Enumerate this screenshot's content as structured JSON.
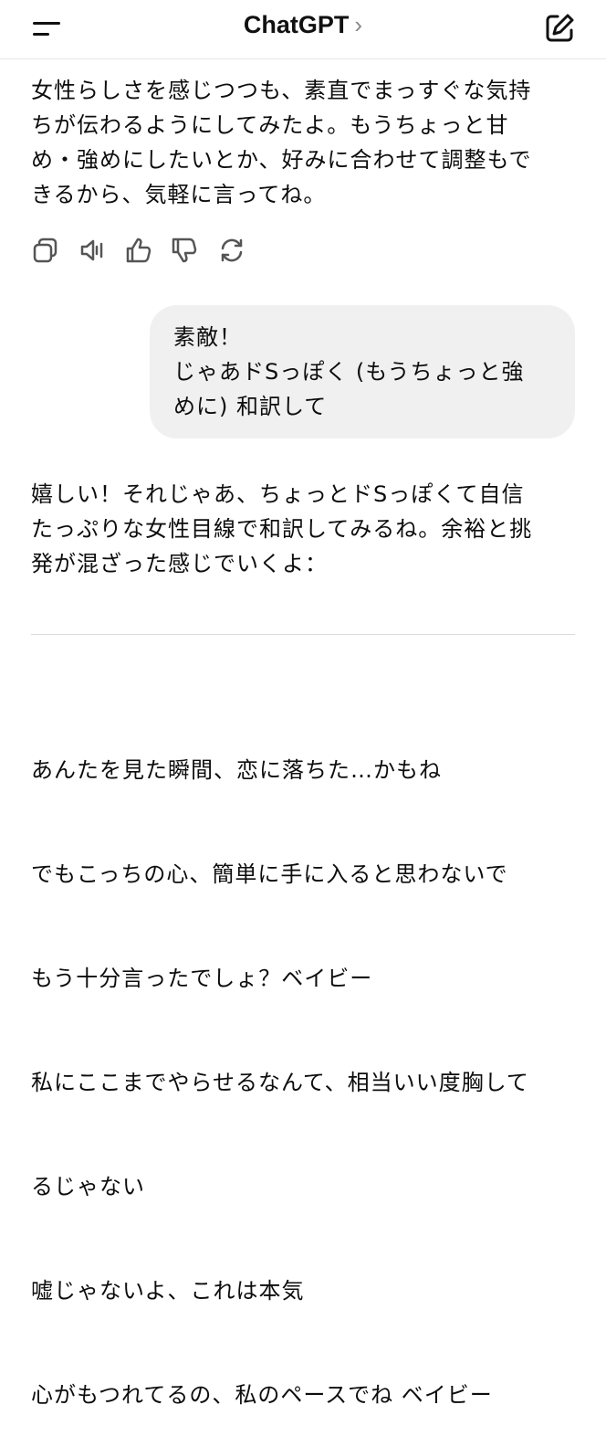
{
  "header": {
    "title": "ChatGPT",
    "chevron": "›"
  },
  "messages": {
    "assistant_1": "女性らしさを感じつつも、素直でまっすぐな気持\nちが伝わるようにしてみたよ。もうちょっと甘\nめ・強めにしたいとか、好みに合わせて調整もで\nきるから、気軽に言ってね。",
    "user_1": "素敵！\nじゃあドSっぽく (もうちょっと強\nめに) 和訳して",
    "assistant_2": "嬉しい！それじゃあ、ちょっとドSっぽくて自信\nたっぷりな女性目線で和訳してみるね。余裕と挑\n発が混ざった感じでいくよ：",
    "poem": [
      "あんたを見た瞬間、恋に落ちた…かもね",
      "でもこっちの心、簡単に手に入ると思わないで",
      "もう十分言ったでしょ？ベイビー",
      "私にここまでやらせるなんて、相当いい度胸して",
      "るじゃない",
      "嘘じゃないよ、これは本気",
      "心がもつれてるの、私のペースでね ベイビー"
    ]
  },
  "icons": [
    "menu-icon",
    "edit-icon",
    "copy-icon",
    "speaker-icon",
    "thumbs-up-icon",
    "thumbs-down-icon",
    "regenerate-icon"
  ]
}
